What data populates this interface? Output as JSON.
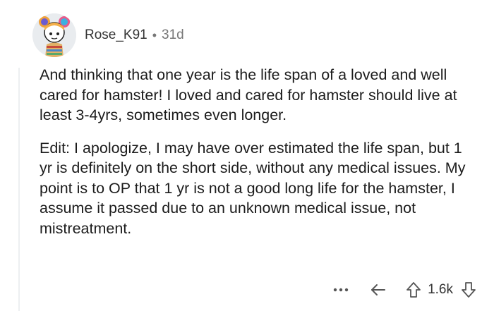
{
  "comment": {
    "username": "Rose_K91",
    "separator": "•",
    "age": "31d",
    "paragraphs": [
      "And thinking that one year is the life span of a loved and well cared for hamster! I loved and cared for hamster should live at least 3-4yrs, sometimes even longer.",
      "Edit: I apologize, I may have over estimated the life span, but 1 yr is definitely on the short side, without any medical issues. My point is to OP that 1 yr is not a good long life for the hamster, I assume it passed due to an unknown medical issue, not mistreatment."
    ],
    "score": "1.6k"
  },
  "icons": {
    "more": "more-options-icon",
    "reply": "reply-icon",
    "upvote": "upvote-arrow-icon",
    "downvote": "downvote-arrow-icon"
  },
  "colors": {
    "text": "#1c1c1c",
    "meta": "#777777",
    "thread_line": "#edeff1",
    "avatar_bg": "#e9ecef"
  }
}
